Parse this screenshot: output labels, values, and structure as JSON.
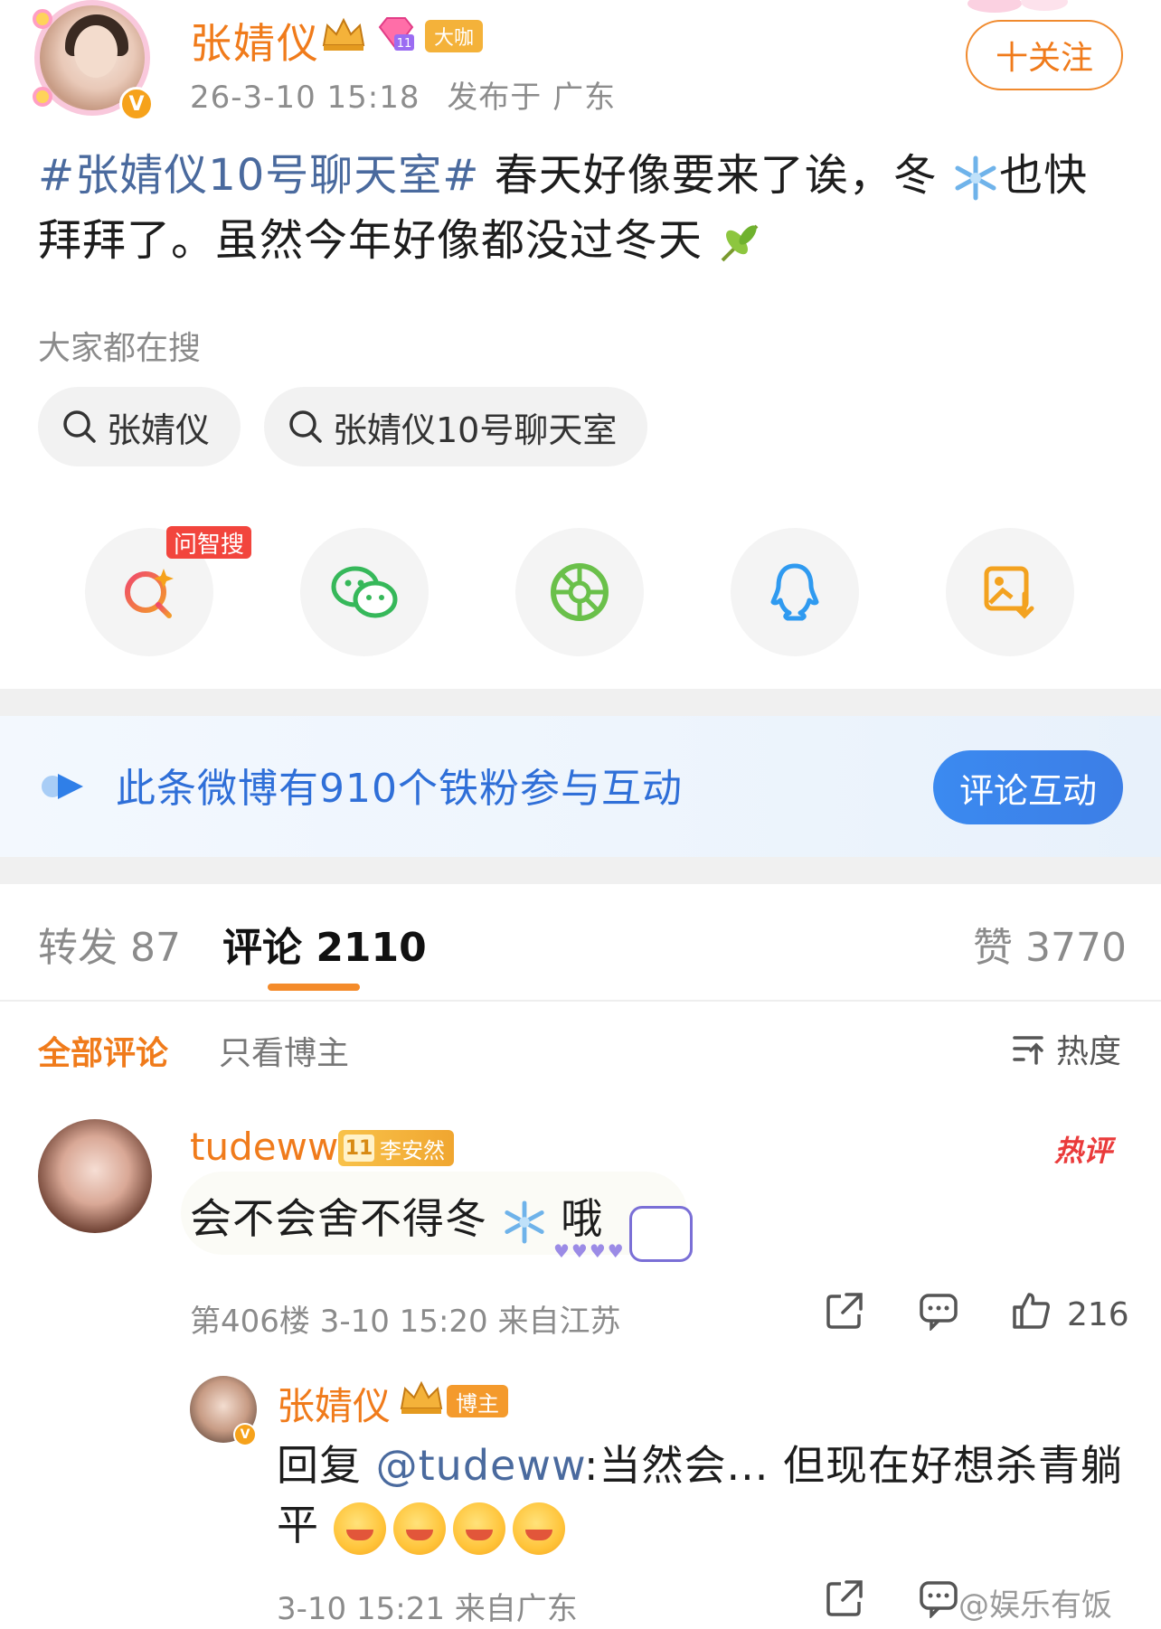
{
  "post": {
    "author": "张婧仪",
    "level_badge": "11",
    "identity_tag": "大咖",
    "time": "26-3-10 15:18",
    "location": "发布于 广东",
    "follow_label": "十关注",
    "hashtag": "#张婧仪10号聊天室#",
    "text_part1": " 春天好像要来了诶，冬",
    "text_part2": "也快拜拜了。虽然今年好像都没过冬天"
  },
  "search": {
    "title": "大家都在搜",
    "chips": [
      "张婧仪",
      "张婧仪10号聊天室"
    ]
  },
  "share": {
    "ai_badge": "问智搜",
    "icons": [
      "ai-search-icon",
      "wechat-icon",
      "moments-icon",
      "qq-icon",
      "save-image-icon"
    ]
  },
  "fan_banner": {
    "text": "此条微博有910个铁粉参与互动",
    "button": "评论互动"
  },
  "tabs": {
    "repost": "转发 87",
    "comment": "评论 2110",
    "like": "赞 3770"
  },
  "filters": {
    "all": "全部评论",
    "author_only": "只看博主",
    "sort": "热度"
  },
  "comment": {
    "username": "tudeww",
    "badge_level": "11",
    "badge_name": "李安然",
    "hot_tag": "热评",
    "text_part1": "会不会舍不得冬",
    "text_part2": "哦",
    "hearts": "♥♥♥♥",
    "meta": "第406楼 3-10 15:20 来自江苏",
    "likes": "216"
  },
  "reply": {
    "username": "张婧仪",
    "tag": "博主",
    "prefix": "回复 ",
    "mention": "@tudeww",
    "text": ":当然会... 但现在好想杀青躺平",
    "meta": "3-10 15:21 来自广东",
    "watermark": "@娱乐有饭"
  },
  "colors": {
    "accent_orange": "#f07b1b",
    "link_blue": "#4a6a9e",
    "banner_blue": "#2f6fd8"
  }
}
